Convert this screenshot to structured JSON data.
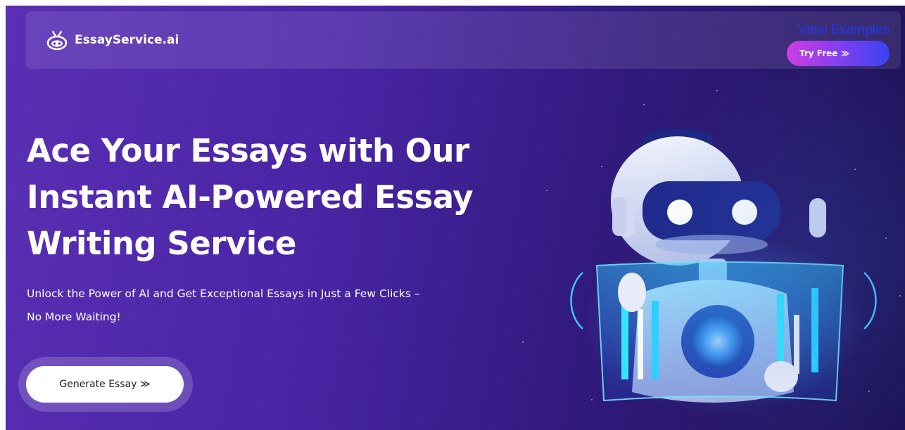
{
  "navbar": {
    "brand": "EssayService.ai",
    "view_examples_label": "View Examples",
    "try_free_label": "Try Free ≫"
  },
  "hero": {
    "headline": "Ace Your Essays with Our Instant AI-Powered Essay Writing Service",
    "subtitle": "Unlock the Power of AI and Get Exceptional Essays in Just a Few Clicks – No More Waiting!",
    "cta_label": "Generate Essay ≫"
  },
  "colors": {
    "background_start": "#5a2fb3",
    "background_end": "#1d1356",
    "cta_background": "#ffffff",
    "try_free_gradient_start": "#d13ce3",
    "try_free_gradient_end": "#3a44f2",
    "link_color": "#1f3bf0"
  },
  "icons": {
    "logo": "robot-head-logo-icon",
    "illustration": "ai-robot-illustration"
  }
}
